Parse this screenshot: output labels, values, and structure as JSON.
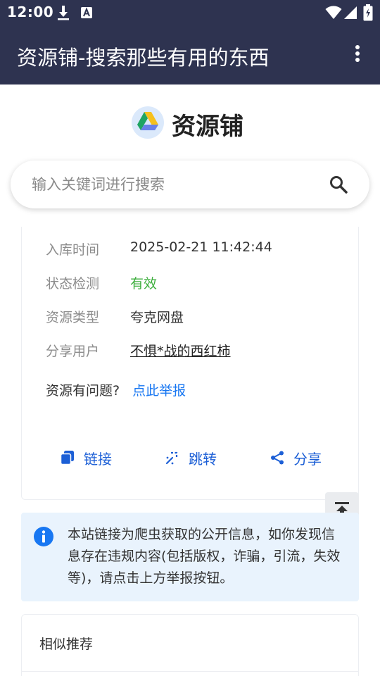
{
  "status_bar": {
    "time": "12:00",
    "icons": [
      "download-icon",
      "a-notification-icon",
      "wifi-icon",
      "signal-icon",
      "battery-icon"
    ]
  },
  "app_bar": {
    "title": "资源铺-搜索那些有用的东西",
    "menu_icon": "more-vert-icon"
  },
  "brand": {
    "name": "资源铺",
    "logo_icon": "drive-logo-icon"
  },
  "search": {
    "placeholder": "输入关键词进行搜索",
    "value": "",
    "icon": "search-icon"
  },
  "details": [
    {
      "label": "入库时间",
      "value": "2025-02-21 11:42:44"
    },
    {
      "label": "状态检测",
      "value": "有效"
    },
    {
      "label": "资源类型",
      "value": "夸克网盘"
    },
    {
      "label": "分享用户",
      "value": "不惧*战的西红柿"
    }
  ],
  "report": {
    "question": "资源有问题?",
    "link": "点此举报"
  },
  "actions": [
    {
      "label": "链接",
      "icon": "copy-icon"
    },
    {
      "label": "跳转",
      "icon": "jump-icon"
    },
    {
      "label": "分享",
      "icon": "share-icon"
    }
  ],
  "floating": {
    "top_icon": "back-to-top-icon",
    "theme_icon": "brightness-icon"
  },
  "notice": {
    "icon": "info-icon",
    "text": "本站链接为爬虫获取的公开信息，如你发现信息存在违规内容(包括版权，诈骗，引流，失效等)，请点击上方举报按钮。"
  },
  "similar": {
    "title": "相似推荐"
  },
  "colors": {
    "app_bar": "#2e3350",
    "valid_green": "#3cae3c",
    "link_blue": "#1877f2",
    "action_blue": "#1c5fd6",
    "notice_bg": "#e9f3fd"
  }
}
